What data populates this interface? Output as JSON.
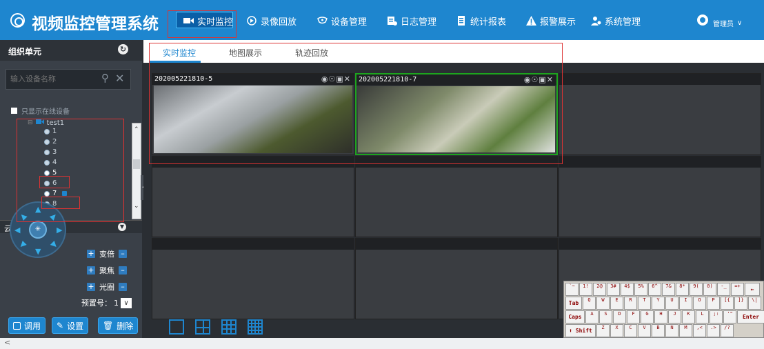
{
  "header": {
    "app_title": "视频监控管理系统",
    "nav": [
      {
        "label": "实时监控",
        "icon": "camera-icon",
        "active": true
      },
      {
        "label": "录像回放",
        "icon": "play-circle-icon"
      },
      {
        "label": "设备管理",
        "icon": "device-icon"
      },
      {
        "label": "日志管理",
        "icon": "log-icon"
      },
      {
        "label": "统计报表",
        "icon": "report-icon"
      },
      {
        "label": "报警展示",
        "icon": "alarm-icon"
      },
      {
        "label": "系统管理",
        "icon": "user-settings-icon"
      }
    ],
    "user_label": "管理员",
    "brand_color": "#1e86cf"
  },
  "sidebar": {
    "title": "组织单元",
    "search_placeholder": "输入设备名称",
    "online_only_label": "只显示在线设备",
    "tree": {
      "group_label": "test1",
      "channels": [
        "1",
        "2",
        "3",
        "4",
        "5",
        "6",
        "7",
        "8"
      ]
    },
    "ptz": {
      "title": "云台控制",
      "controls": [
        "变倍",
        "聚焦",
        "光圈"
      ],
      "preset_label": "预置号：",
      "preset_value": "1"
    },
    "buttons": {
      "call": "调用",
      "set": "设置",
      "delete": "删除"
    }
  },
  "main": {
    "tabs": [
      {
        "label": "实时监控",
        "active": true
      },
      {
        "label": "地图展示"
      },
      {
        "label": "轨迹回放"
      }
    ],
    "cells": [
      {
        "label": "202005221810-5"
      },
      {
        "label": "202005221810-7"
      }
    ]
  },
  "keyboard": {
    "row1": [
      "`~",
      "1!",
      "2@",
      "3#",
      "4$",
      "5%",
      "6^",
      "7&",
      "8*",
      "9(",
      "0)",
      "-_",
      "=+"
    ],
    "row2": [
      "Q",
      "W",
      "E",
      "R",
      "T",
      "Y",
      "U",
      "I",
      "O",
      "P",
      "[{",
      "]}",
      "\\|"
    ],
    "row3": [
      "A",
      "S",
      "D",
      "F",
      "G",
      "H",
      "J",
      "K",
      "L",
      ";:",
      "'\""
    ],
    "row4": [
      "Z",
      "X",
      "C",
      "V",
      "B",
      "N",
      "M",
      ",<",
      ".>",
      "/?"
    ],
    "tab": "Tab",
    "caps": "Caps",
    "shift": "Shift",
    "enter": "Enter"
  }
}
